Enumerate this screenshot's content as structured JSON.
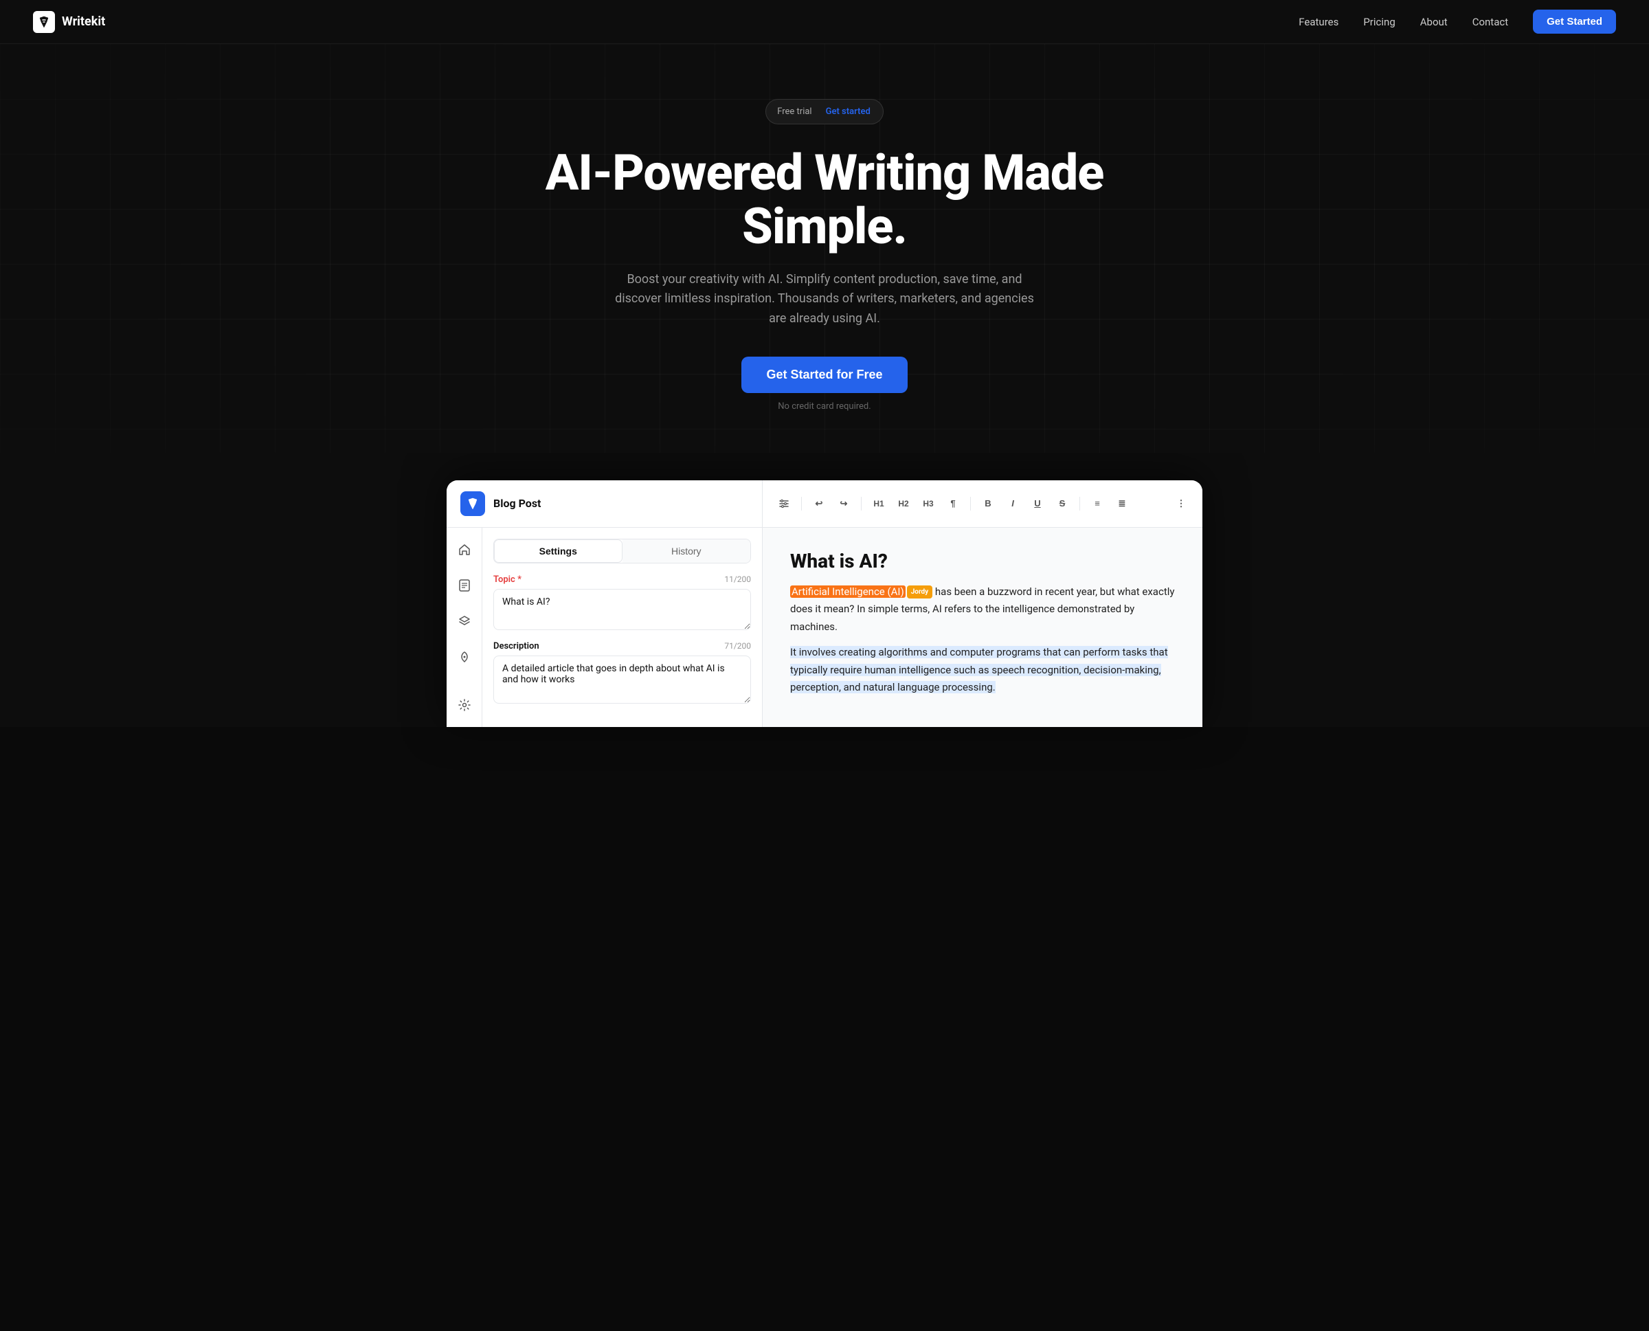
{
  "nav": {
    "logo_text": "Writekit",
    "links": [
      "Features",
      "Pricing",
      "About",
      "Contact"
    ],
    "cta_label": "Get Started"
  },
  "hero": {
    "badge_text": "Free trial",
    "badge_link": "Get started",
    "title": "AI-Powered Writing Made Simple.",
    "subtitle": "Boost your creativity with AI. Simplify content production, save time, and discover limitless inspiration. Thousands of writers, marketers, and agencies are already using AI.",
    "cta_label": "Get Started for Free",
    "note": "No credit card required."
  },
  "app": {
    "title": "Blog Post",
    "tabs": [
      "Settings",
      "History"
    ],
    "active_tab": "Settings",
    "topic_label": "Topic",
    "topic_count": "11/200",
    "topic_value": "What is AI?",
    "description_label": "Description",
    "description_count": "71/200",
    "description_value": "A detailed article that goes in depth about what AI is and how it works",
    "editor_title": "What is AI?",
    "editor_tooltip": "Jordy",
    "editor_para1_highlight": "Artificial Intelligence (AI)",
    "editor_para1_rest": " has been a buzzword in recent year, but what exactly does it mean? In simple terms, AI refers to the intelligence demonstrated by machines.",
    "editor_para2_highlight": "It involves creating algorithms and computer programs that can perform tasks that typically require human intelligence such as speech recognition, decision-making, perception, and natural language processing.",
    "toolbar": {
      "undo": "↩",
      "redo": "↪",
      "h1": "H1",
      "h2": "H2",
      "h3": "H3",
      "paragraph": "¶",
      "bold": "B",
      "italic": "I",
      "underline": "U",
      "strikethrough": "S",
      "list_ul": "≡",
      "list_ol": "≣",
      "more": "⋮",
      "settings": "⊞"
    }
  }
}
